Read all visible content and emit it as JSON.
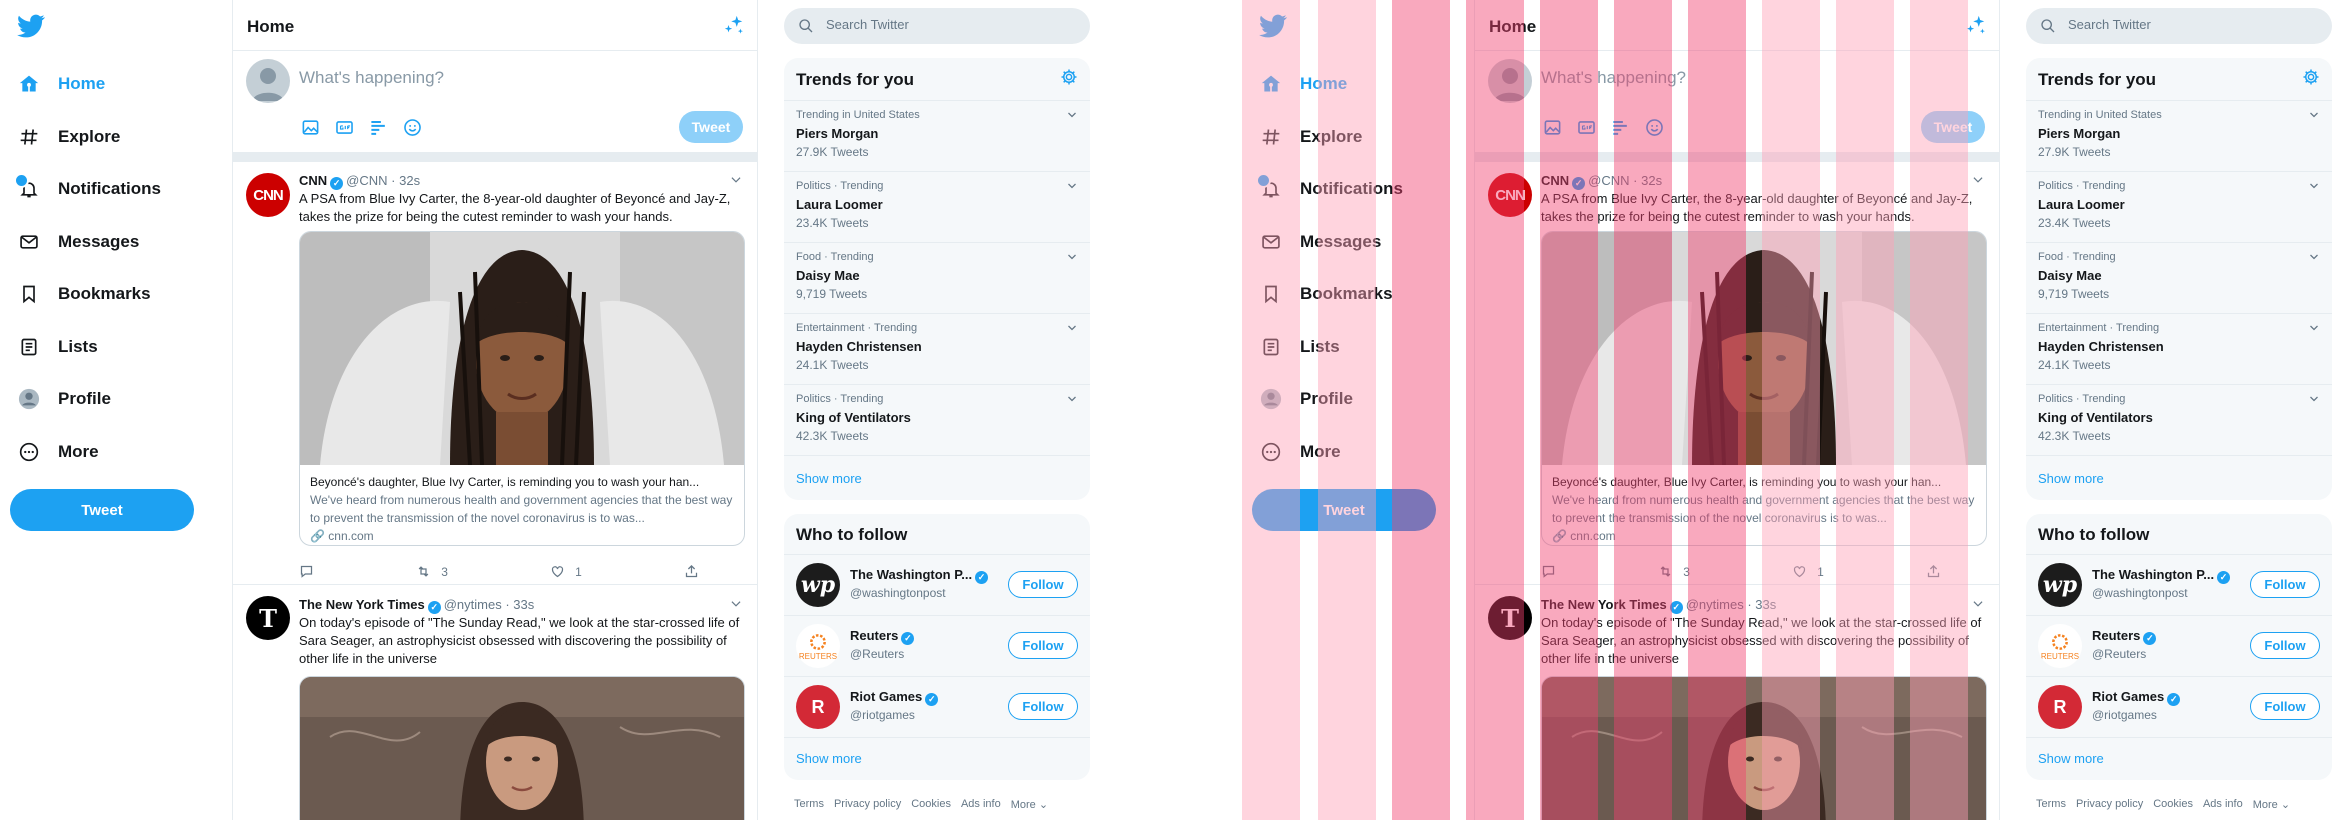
{
  "sidebar": {
    "items": [
      {
        "label": "Home",
        "icon": "home-icon",
        "active": true
      },
      {
        "label": "Explore",
        "icon": "hashtag-icon"
      },
      {
        "label": "Notifications",
        "icon": "bell-icon",
        "badge": true
      },
      {
        "label": "Messages",
        "icon": "envelope-icon"
      },
      {
        "label": "Bookmarks",
        "icon": "bookmark-icon"
      },
      {
        "label": "Lists",
        "icon": "list-icon"
      },
      {
        "label": "Profile",
        "icon": "user-icon"
      },
      {
        "label": "More",
        "icon": "more-icon"
      }
    ],
    "tweet_label": "Tweet"
  },
  "main": {
    "title": "Home",
    "composer_placeholder": "What's happening?",
    "tweet_label": "Tweet"
  },
  "tweets": [
    {
      "name": "CNN",
      "handle": "@CNN",
      "time": "· 32s",
      "avatar_text": "CNN",
      "text": "A PSA from Blue Ivy Carter, the 8-year-old daughter of Beyoncé and Jay-Z, takes the prize for being the cutest reminder to wash your hands.",
      "card_title": "Beyoncé's daughter, Blue Ivy Carter, is reminding you to wash your han...",
      "card_desc": "We've heard from numerous health and government agencies that the best way to prevent the transmission of the novel coronavirus is to was...",
      "card_link": "cnn.com",
      "retweets": "3",
      "likes": "1"
    },
    {
      "name": "The New York Times",
      "handle": "@nytimes",
      "time": "· 33s",
      "avatar_text": "T",
      "text": "On today's episode of \"The Sunday Read,\" we look at the star-crossed life of Sara Seager, an astrophysicist obsessed with discovering the possibility of other life in the universe"
    }
  ],
  "search": {
    "placeholder": "Search Twitter"
  },
  "trends": {
    "title": "Trends for you",
    "items": [
      {
        "meta": "Trending in United States",
        "name": "Piers Morgan",
        "count": "27.9K Tweets"
      },
      {
        "meta": "Politics · Trending",
        "name": "Laura Loomer",
        "count": "23.4K Tweets"
      },
      {
        "meta": "Food · Trending",
        "name": "Daisy Mae",
        "count": "9,719 Tweets"
      },
      {
        "meta": "Entertainment · Trending",
        "name": "Hayden Christensen",
        "count": "24.1K Tweets"
      },
      {
        "meta": "Politics · Trending",
        "name": "King of Ventilators",
        "count": "42.3K Tweets"
      }
    ],
    "show_more": "Show more"
  },
  "who_to_follow": {
    "title": "Who to follow",
    "items": [
      {
        "name": "The Washington P...",
        "handle": "@washingtonpost",
        "avatar_text": "wp"
      },
      {
        "name": "Reuters",
        "handle": "@Reuters",
        "avatar_text": "REUTERS"
      },
      {
        "name": "Riot Games",
        "handle": "@riotgames",
        "avatar_text": "R"
      }
    ],
    "follow_label": "Follow",
    "show_more": "Show more"
  },
  "footer": {
    "links": [
      "Terms",
      "Privacy policy",
      "Cookies",
      "Ads info",
      "More ⌄"
    ]
  },
  "colors": {
    "accent": "#1da1f2",
    "overlay_light": "#ffa0b6",
    "overlay_dark": "#f2406e"
  }
}
